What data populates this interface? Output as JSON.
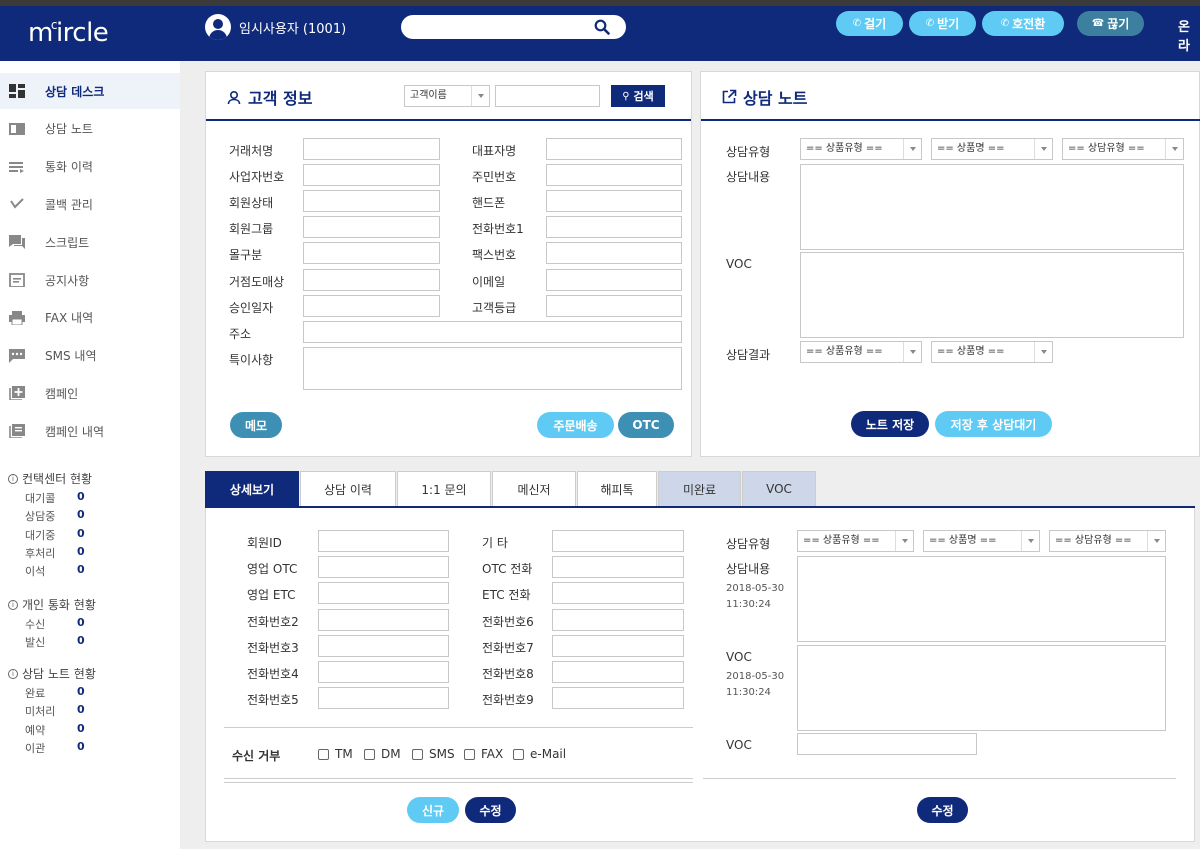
{
  "app": {
    "logo": "m circle",
    "logo_accent": "c"
  },
  "header": {
    "user": "임시사용자 (1001)",
    "search_placeholder": "",
    "buttons": {
      "call": "걸기",
      "receive": "받기",
      "transfer": "호전환",
      "hangup": "끊기"
    },
    "status": "온라"
  },
  "sidebar": {
    "items": [
      {
        "label": "상담 데스크",
        "icon": "dashboard-icon"
      },
      {
        "label": "상담 노트",
        "icon": "note-icon"
      },
      {
        "label": "통화 이력",
        "icon": "list-icon"
      },
      {
        "label": "콜백 관리",
        "icon": "callback-icon"
      },
      {
        "label": "스크립트",
        "icon": "chat-icon"
      },
      {
        "label": "공지사항",
        "icon": "calendar-icon"
      },
      {
        "label": "FAX 내역",
        "icon": "printer-icon"
      },
      {
        "label": "SMS 내역",
        "icon": "sms-icon"
      },
      {
        "label": "캠페인",
        "icon": "add-box-icon"
      },
      {
        "label": "캠페인 내역",
        "icon": "book-icon"
      }
    ],
    "stats": [
      {
        "title": "컨택센터 현황",
        "rows": [
          {
            "label": "대기콜",
            "value": "0"
          },
          {
            "label": "상담중",
            "value": "0"
          },
          {
            "label": "대기중",
            "value": "0"
          },
          {
            "label": "후처리",
            "value": "0"
          },
          {
            "label": "이석",
            "value": "0"
          }
        ]
      },
      {
        "title": "개인 통화 현황",
        "rows": [
          {
            "label": "수신",
            "value": "0"
          },
          {
            "label": "발신",
            "value": "0"
          }
        ]
      },
      {
        "title": "상담 노트 현황",
        "rows": [
          {
            "label": "완료",
            "value": "0"
          },
          {
            "label": "미처리",
            "value": "0"
          },
          {
            "label": "예약",
            "value": "0"
          },
          {
            "label": "이관",
            "value": "0"
          }
        ]
      }
    ]
  },
  "customer": {
    "title": "고객 정보",
    "search_type": "고객이름",
    "search_button": "검색",
    "fields_left": [
      "거래처명",
      "사업자번호",
      "회원상태",
      "회원그룹",
      "몰구분",
      "거점도매상",
      "승인일자"
    ],
    "fields_right": [
      "대표자명",
      "주민번호",
      "핸드폰",
      "전화번호1",
      "팩스번호",
      "이메일",
      "고객등급"
    ],
    "address": "주소",
    "note": "특이사항",
    "memo_button": "메모",
    "order_button": "주문배송",
    "otc_button": "OTC"
  },
  "consult": {
    "title": "상담 노트",
    "type_label": "상담유형",
    "content_label": "상담내용",
    "voc_label": "VOC",
    "result_label": "상담결과",
    "select_product_type": "== 상품유형 ==",
    "select_product_name": "== 상품명 ==",
    "select_consult_type": "== 상담유형 ==",
    "save_button": "노트 저장",
    "save_wait_button": "저장 후 상담대기"
  },
  "tabs": [
    "상세보기",
    "상담 이력",
    "1:1 문의",
    "메신저",
    "해피톡",
    "미완료",
    "VOC"
  ],
  "detail": {
    "fields_left": [
      "회원ID",
      "영업 OTC",
      "영업 ETC",
      "전화번호2",
      "전화번호3",
      "전화번호4",
      "전화번호5"
    ],
    "fields_right": [
      "기 타",
      "OTC 전화",
      "ETC 전화",
      "전화번호6",
      "전화번호7",
      "전화번호8",
      "전화번호9"
    ],
    "reject_label": "수신 거부",
    "reject_options": [
      "TM",
      "DM",
      "SMS",
      "FAX",
      "e-Mail"
    ],
    "new_button": "신규",
    "edit_button": "수정",
    "right": {
      "type_label": "상담유형",
      "content_label": "상담내용",
      "content_date": "2018-05-30",
      "content_time": "11:30:24",
      "voc_label": "VOC",
      "voc_date": "2018-05-30",
      "voc_time": "11:30:24",
      "voc2_label": "VOC",
      "edit_button": "수정"
    }
  },
  "colors": {
    "navy": "#0f2a7a",
    "sky": "#5fcbf4",
    "teal": "#3d8fb3"
  }
}
